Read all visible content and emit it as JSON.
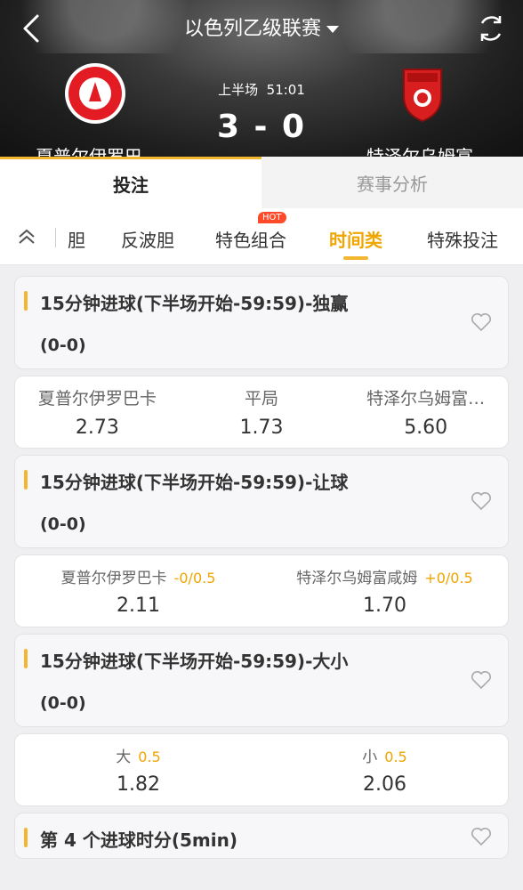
{
  "header": {
    "league": "以色列乙级联赛",
    "period": "上半场",
    "time": "51:01",
    "score": "3 - 0",
    "home_team": "夏普尔伊罗巴",
    "away_team": "特泽尔乌姆富"
  },
  "main_tabs": [
    "投注",
    "赛事分析"
  ],
  "sub_tabs": [
    "胆",
    "反波胆",
    "特色组合",
    "时间类",
    "特殊投注"
  ],
  "hot_badge": "HOT",
  "markets": [
    {
      "title": "15分钟进球(下半场开始-59:59)-独赢",
      "score": "(0-0)",
      "odds": [
        {
          "label": "夏普尔伊罗巴卡",
          "price": "2.73"
        },
        {
          "label": "平局",
          "price": "1.73"
        },
        {
          "label": "特泽尔乌姆富…",
          "price": "5.60"
        }
      ]
    },
    {
      "title": "15分钟进球(下半场开始-59:59)-让球",
      "score": "(0-0)",
      "odds": [
        {
          "label": "夏普尔伊罗巴卡",
          "handicap": "-0/0.5",
          "price": "2.11"
        },
        {
          "label": "特泽尔乌姆富咸姆",
          "handicap": "+0/0.5",
          "price": "1.70"
        }
      ]
    },
    {
      "title": "15分钟进球(下半场开始-59:59)-大小",
      "score": "(0-0)",
      "odds": [
        {
          "label": "大",
          "handicap": "0.5",
          "price": "1.82"
        },
        {
          "label": "小",
          "handicap": "0.5",
          "price": "2.06"
        }
      ]
    },
    {
      "title": "第 4 个进球时分(5min)"
    }
  ],
  "colors": {
    "accent": "#f3b62f",
    "active_text": "#f0a500",
    "hot": "#ff4a2a"
  }
}
